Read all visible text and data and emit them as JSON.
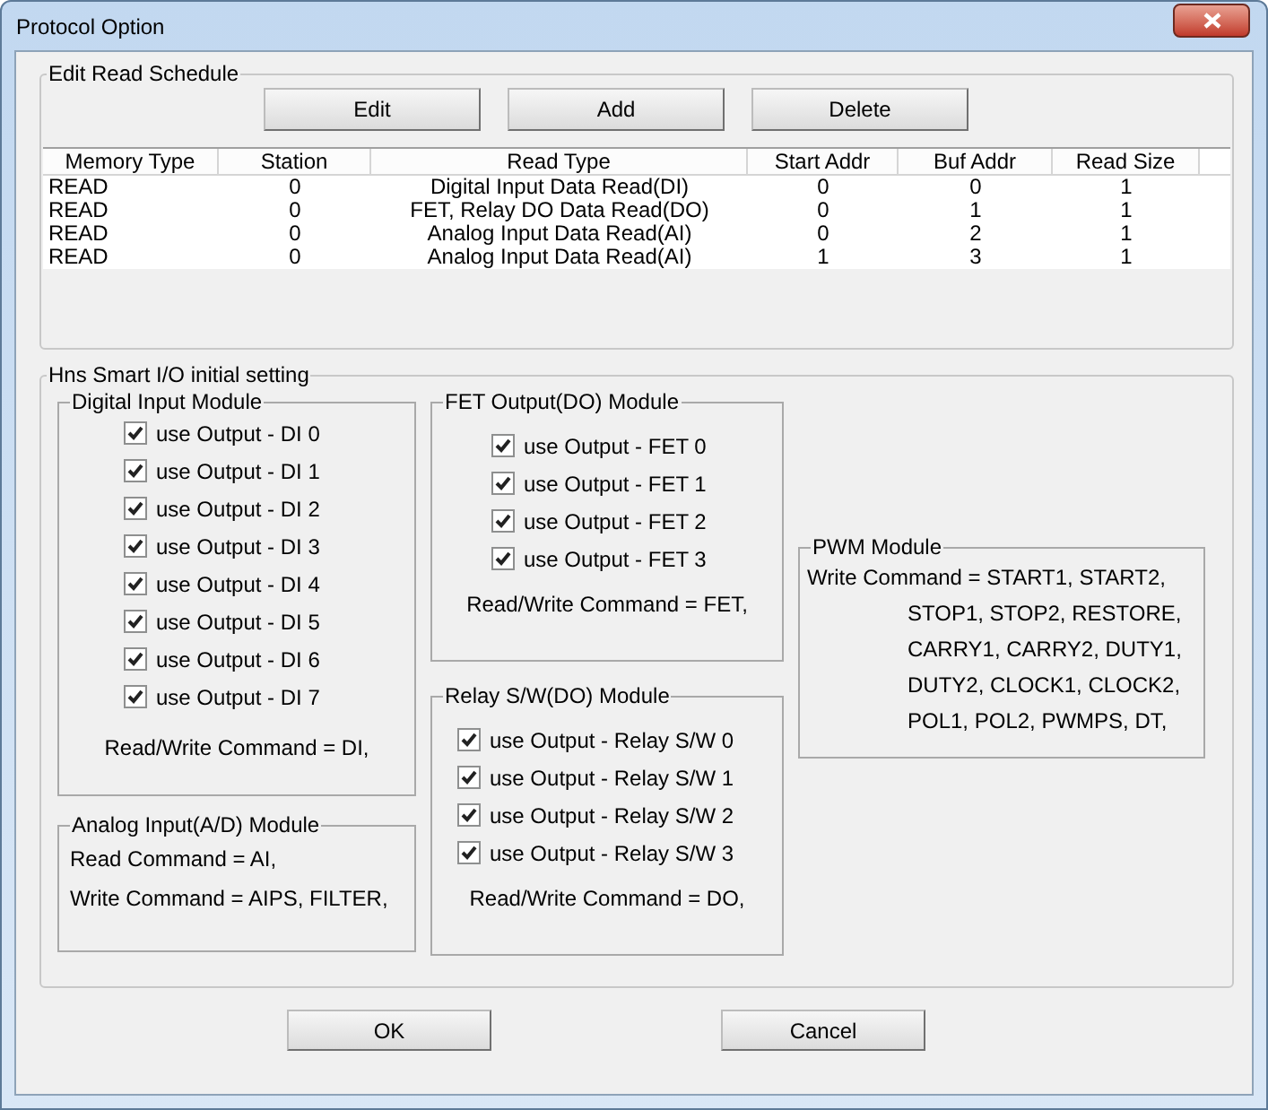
{
  "window": {
    "title": "Protocol Option"
  },
  "read_schedule": {
    "title": "Edit Read Schedule",
    "buttons": [
      "Edit",
      "Add",
      "Delete"
    ],
    "columns": [
      "Memory Type",
      "Station",
      "Read Type",
      "Start Addr",
      "Buf Addr",
      "Read Size"
    ],
    "rows": [
      [
        "READ",
        "0",
        "Digital Input Data Read(DI)",
        "0",
        "0",
        "1"
      ],
      [
        "READ",
        "0",
        "FET, Relay DO Data Read(DO)",
        "0",
        "1",
        "1"
      ],
      [
        "READ",
        "0",
        "Analog Input Data Read(AI)",
        "0",
        "2",
        "1"
      ],
      [
        "READ",
        "0",
        "Analog Input Data Read(AI)",
        "1",
        "3",
        "1"
      ]
    ]
  },
  "initial_setting": {
    "title": "Hns Smart I/O initial setting",
    "digital_input": {
      "title": "Digital Input Module",
      "options": [
        {
          "label": "use Output - DI 0",
          "checked": true
        },
        {
          "label": "use Output - DI 1",
          "checked": true
        },
        {
          "label": "use Output - DI 2",
          "checked": true
        },
        {
          "label": "use Output - DI 3",
          "checked": true
        },
        {
          "label": "use Output - DI 4",
          "checked": true
        },
        {
          "label": "use Output - DI 5",
          "checked": true
        },
        {
          "label": "use Output - DI 6",
          "checked": true
        },
        {
          "label": "use Output - DI 7",
          "checked": true
        }
      ],
      "command": "Read/Write Command = DI,"
    },
    "analog_input": {
      "title": "Analog Input(A/D) Module",
      "lines": [
        "Read Command = AI,",
        "Write Command = AIPS, FILTER,"
      ]
    },
    "fet_output": {
      "title": "FET Output(DO) Module",
      "options": [
        {
          "label": "use Output - FET 0",
          "checked": true
        },
        {
          "label": "use Output - FET 1",
          "checked": true
        },
        {
          "label": "use Output - FET 2",
          "checked": true
        },
        {
          "label": "use Output - FET 3",
          "checked": true
        }
      ],
      "command": "Read/Write Command = FET,"
    },
    "relay": {
      "title": "Relay S/W(DO) Module",
      "options": [
        {
          "label": "use Output - Relay S/W 0",
          "checked": true
        },
        {
          "label": "use Output - Relay S/W 1",
          "checked": true
        },
        {
          "label": "use Output - Relay S/W 2",
          "checked": true
        },
        {
          "label": "use Output - Relay S/W 3",
          "checked": true
        }
      ],
      "command": "Read/Write Command = DO,"
    },
    "pwm": {
      "title": "PWM Module",
      "lines": [
        "Write Command = START1, START2,",
        "STOP1, STOP2, RESTORE,",
        "CARRY1, CARRY2, DUTY1,",
        "DUTY2, CLOCK1, CLOCK2,",
        "POL1, POL2, PWMPS, DT,"
      ]
    }
  },
  "buttons": [
    "OK",
    "Cancel"
  ]
}
